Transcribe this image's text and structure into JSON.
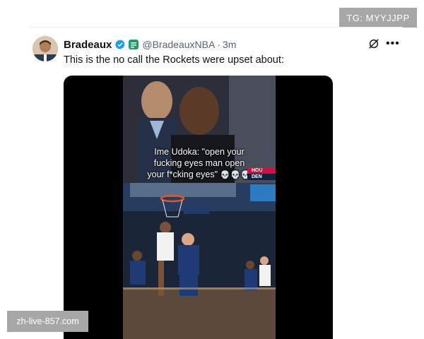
{
  "watermark_top": "TG: MYYJJPP",
  "watermark_bottom": "zh-live-857.com",
  "tweet": {
    "display_name": "Bradeaux",
    "handle": "@BradeauxNBA",
    "separator": "·",
    "time": "3m",
    "text": "This is the no call the Rockets were upset about:",
    "verified_color": "#1d9bf0",
    "affiliate_color": "#1a9e6a"
  },
  "video": {
    "caption_lines": [
      "Ime Udoka: \"open your",
      "fucking eyes man open",
      "your f*cking eyes\""
    ],
    "caption_emoji": "💀💀💀",
    "scorebug_team_1": "HOU",
    "scorebug_team_2": "DEN"
  },
  "icons": {
    "grok": "grok-icon",
    "more": "more-icon",
    "verified": "verified-badge-icon",
    "affiliate": "affiliate-badge-icon"
  }
}
